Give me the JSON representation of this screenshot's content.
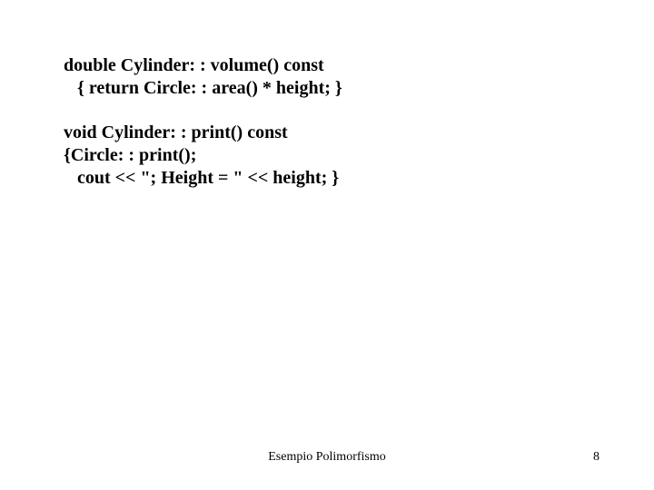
{
  "code": {
    "line1": "double Cylinder: : volume() const",
    "line2": "   { return Circle: : area() * height; }",
    "line3": "void Cylinder: : print() const",
    "line4": "{Circle: : print();",
    "line5": "   cout << \"; Height = \" << height; }"
  },
  "footer": {
    "center": "Esempio Polimorfismo",
    "page": "8"
  }
}
